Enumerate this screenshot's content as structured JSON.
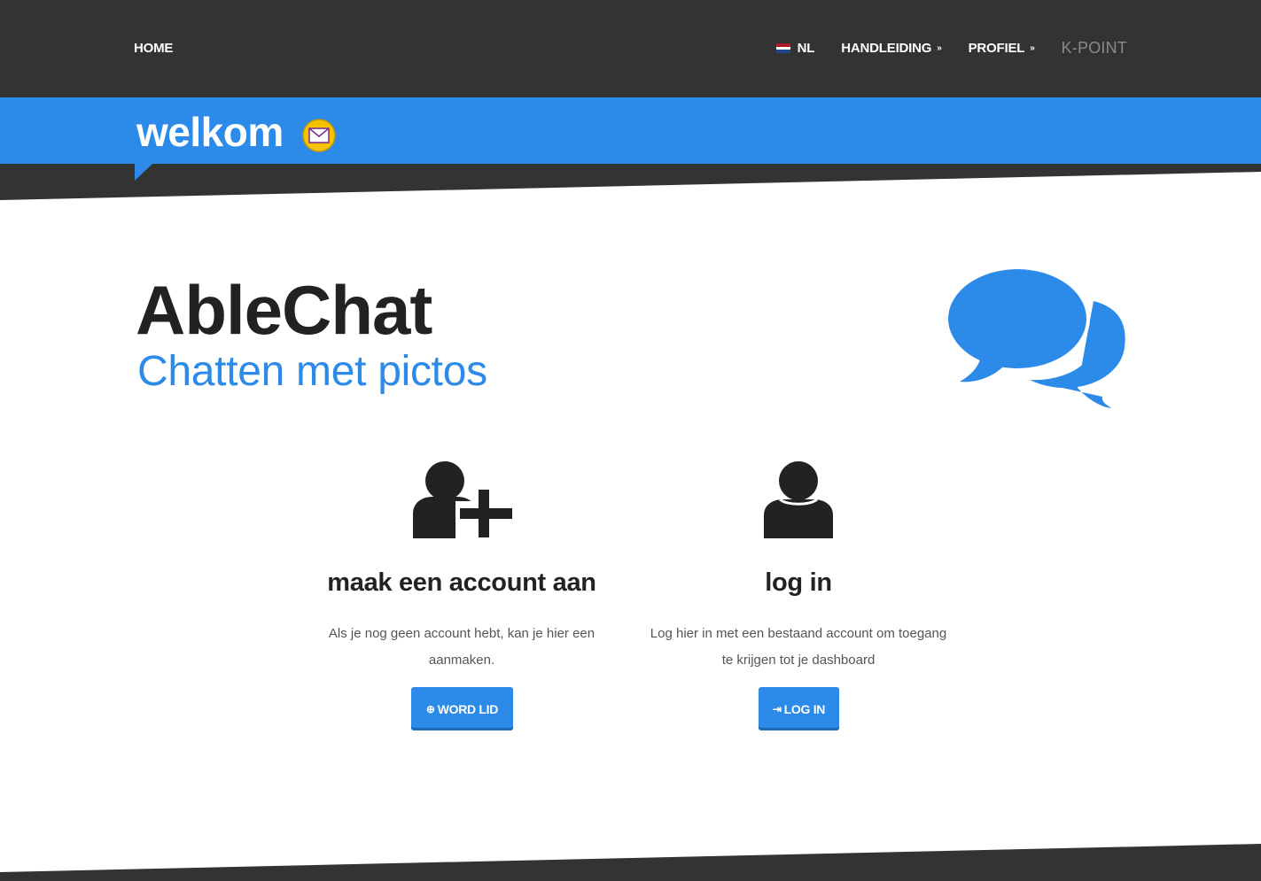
{
  "nav": {
    "home": "HOME",
    "language": "NL",
    "manual": "HANDLEIDING",
    "profile": "PROFIEL",
    "kpoint": "K-POINT"
  },
  "banner": {
    "title": "welkom"
  },
  "hero": {
    "title": "AbleChat",
    "subtitle": "Chatten met pictos"
  },
  "cards": [
    {
      "heading": "maak een account aan",
      "text_line1": "Als je nog geen account hebt, kan je hier een",
      "text_line2": "aanmaken.",
      "button": "WORD LID"
    },
    {
      "heading": "log in",
      "text_line1": "Log hier in met een bestaand account om toegang",
      "text_line2": "te krijgen tot je dashboard",
      "button": "LOG IN"
    }
  ],
  "colors": {
    "accent": "#2c8ae8",
    "dark": "#333333",
    "text": "#222222"
  },
  "icons": {
    "banner": "envelope-icon",
    "hero": "chat-bubbles-icon",
    "signup": "user-plus-icon",
    "login": "user-icon",
    "signup_button": "plus-circle-icon",
    "login_button": "sign-in-icon"
  }
}
